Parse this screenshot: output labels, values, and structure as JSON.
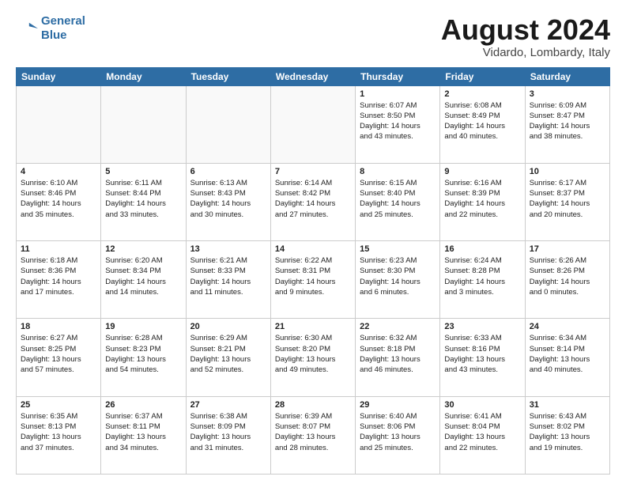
{
  "header": {
    "logo_line1": "General",
    "logo_line2": "Blue",
    "main_title": "August 2024",
    "sub_title": "Vidardo, Lombardy, Italy"
  },
  "weekdays": [
    "Sunday",
    "Monday",
    "Tuesday",
    "Wednesday",
    "Thursday",
    "Friday",
    "Saturday"
  ],
  "weeks": [
    [
      {
        "day": "",
        "info": ""
      },
      {
        "day": "",
        "info": ""
      },
      {
        "day": "",
        "info": ""
      },
      {
        "day": "",
        "info": ""
      },
      {
        "day": "1",
        "info": "Sunrise: 6:07 AM\nSunset: 8:50 PM\nDaylight: 14 hours\nand 43 minutes."
      },
      {
        "day": "2",
        "info": "Sunrise: 6:08 AM\nSunset: 8:49 PM\nDaylight: 14 hours\nand 40 minutes."
      },
      {
        "day": "3",
        "info": "Sunrise: 6:09 AM\nSunset: 8:47 PM\nDaylight: 14 hours\nand 38 minutes."
      }
    ],
    [
      {
        "day": "4",
        "info": "Sunrise: 6:10 AM\nSunset: 8:46 PM\nDaylight: 14 hours\nand 35 minutes."
      },
      {
        "day": "5",
        "info": "Sunrise: 6:11 AM\nSunset: 8:44 PM\nDaylight: 14 hours\nand 33 minutes."
      },
      {
        "day": "6",
        "info": "Sunrise: 6:13 AM\nSunset: 8:43 PM\nDaylight: 14 hours\nand 30 minutes."
      },
      {
        "day": "7",
        "info": "Sunrise: 6:14 AM\nSunset: 8:42 PM\nDaylight: 14 hours\nand 27 minutes."
      },
      {
        "day": "8",
        "info": "Sunrise: 6:15 AM\nSunset: 8:40 PM\nDaylight: 14 hours\nand 25 minutes."
      },
      {
        "day": "9",
        "info": "Sunrise: 6:16 AM\nSunset: 8:39 PM\nDaylight: 14 hours\nand 22 minutes."
      },
      {
        "day": "10",
        "info": "Sunrise: 6:17 AM\nSunset: 8:37 PM\nDaylight: 14 hours\nand 20 minutes."
      }
    ],
    [
      {
        "day": "11",
        "info": "Sunrise: 6:18 AM\nSunset: 8:36 PM\nDaylight: 14 hours\nand 17 minutes."
      },
      {
        "day": "12",
        "info": "Sunrise: 6:20 AM\nSunset: 8:34 PM\nDaylight: 14 hours\nand 14 minutes."
      },
      {
        "day": "13",
        "info": "Sunrise: 6:21 AM\nSunset: 8:33 PM\nDaylight: 14 hours\nand 11 minutes."
      },
      {
        "day": "14",
        "info": "Sunrise: 6:22 AM\nSunset: 8:31 PM\nDaylight: 14 hours\nand 9 minutes."
      },
      {
        "day": "15",
        "info": "Sunrise: 6:23 AM\nSunset: 8:30 PM\nDaylight: 14 hours\nand 6 minutes."
      },
      {
        "day": "16",
        "info": "Sunrise: 6:24 AM\nSunset: 8:28 PM\nDaylight: 14 hours\nand 3 minutes."
      },
      {
        "day": "17",
        "info": "Sunrise: 6:26 AM\nSunset: 8:26 PM\nDaylight: 14 hours\nand 0 minutes."
      }
    ],
    [
      {
        "day": "18",
        "info": "Sunrise: 6:27 AM\nSunset: 8:25 PM\nDaylight: 13 hours\nand 57 minutes."
      },
      {
        "day": "19",
        "info": "Sunrise: 6:28 AM\nSunset: 8:23 PM\nDaylight: 13 hours\nand 54 minutes."
      },
      {
        "day": "20",
        "info": "Sunrise: 6:29 AM\nSunset: 8:21 PM\nDaylight: 13 hours\nand 52 minutes."
      },
      {
        "day": "21",
        "info": "Sunrise: 6:30 AM\nSunset: 8:20 PM\nDaylight: 13 hours\nand 49 minutes."
      },
      {
        "day": "22",
        "info": "Sunrise: 6:32 AM\nSunset: 8:18 PM\nDaylight: 13 hours\nand 46 minutes."
      },
      {
        "day": "23",
        "info": "Sunrise: 6:33 AM\nSunset: 8:16 PM\nDaylight: 13 hours\nand 43 minutes."
      },
      {
        "day": "24",
        "info": "Sunrise: 6:34 AM\nSunset: 8:14 PM\nDaylight: 13 hours\nand 40 minutes."
      }
    ],
    [
      {
        "day": "25",
        "info": "Sunrise: 6:35 AM\nSunset: 8:13 PM\nDaylight: 13 hours\nand 37 minutes."
      },
      {
        "day": "26",
        "info": "Sunrise: 6:37 AM\nSunset: 8:11 PM\nDaylight: 13 hours\nand 34 minutes."
      },
      {
        "day": "27",
        "info": "Sunrise: 6:38 AM\nSunset: 8:09 PM\nDaylight: 13 hours\nand 31 minutes."
      },
      {
        "day": "28",
        "info": "Sunrise: 6:39 AM\nSunset: 8:07 PM\nDaylight: 13 hours\nand 28 minutes."
      },
      {
        "day": "29",
        "info": "Sunrise: 6:40 AM\nSunset: 8:06 PM\nDaylight: 13 hours\nand 25 minutes."
      },
      {
        "day": "30",
        "info": "Sunrise: 6:41 AM\nSunset: 8:04 PM\nDaylight: 13 hours\nand 22 minutes."
      },
      {
        "day": "31",
        "info": "Sunrise: 6:43 AM\nSunset: 8:02 PM\nDaylight: 13 hours\nand 19 minutes."
      }
    ]
  ]
}
